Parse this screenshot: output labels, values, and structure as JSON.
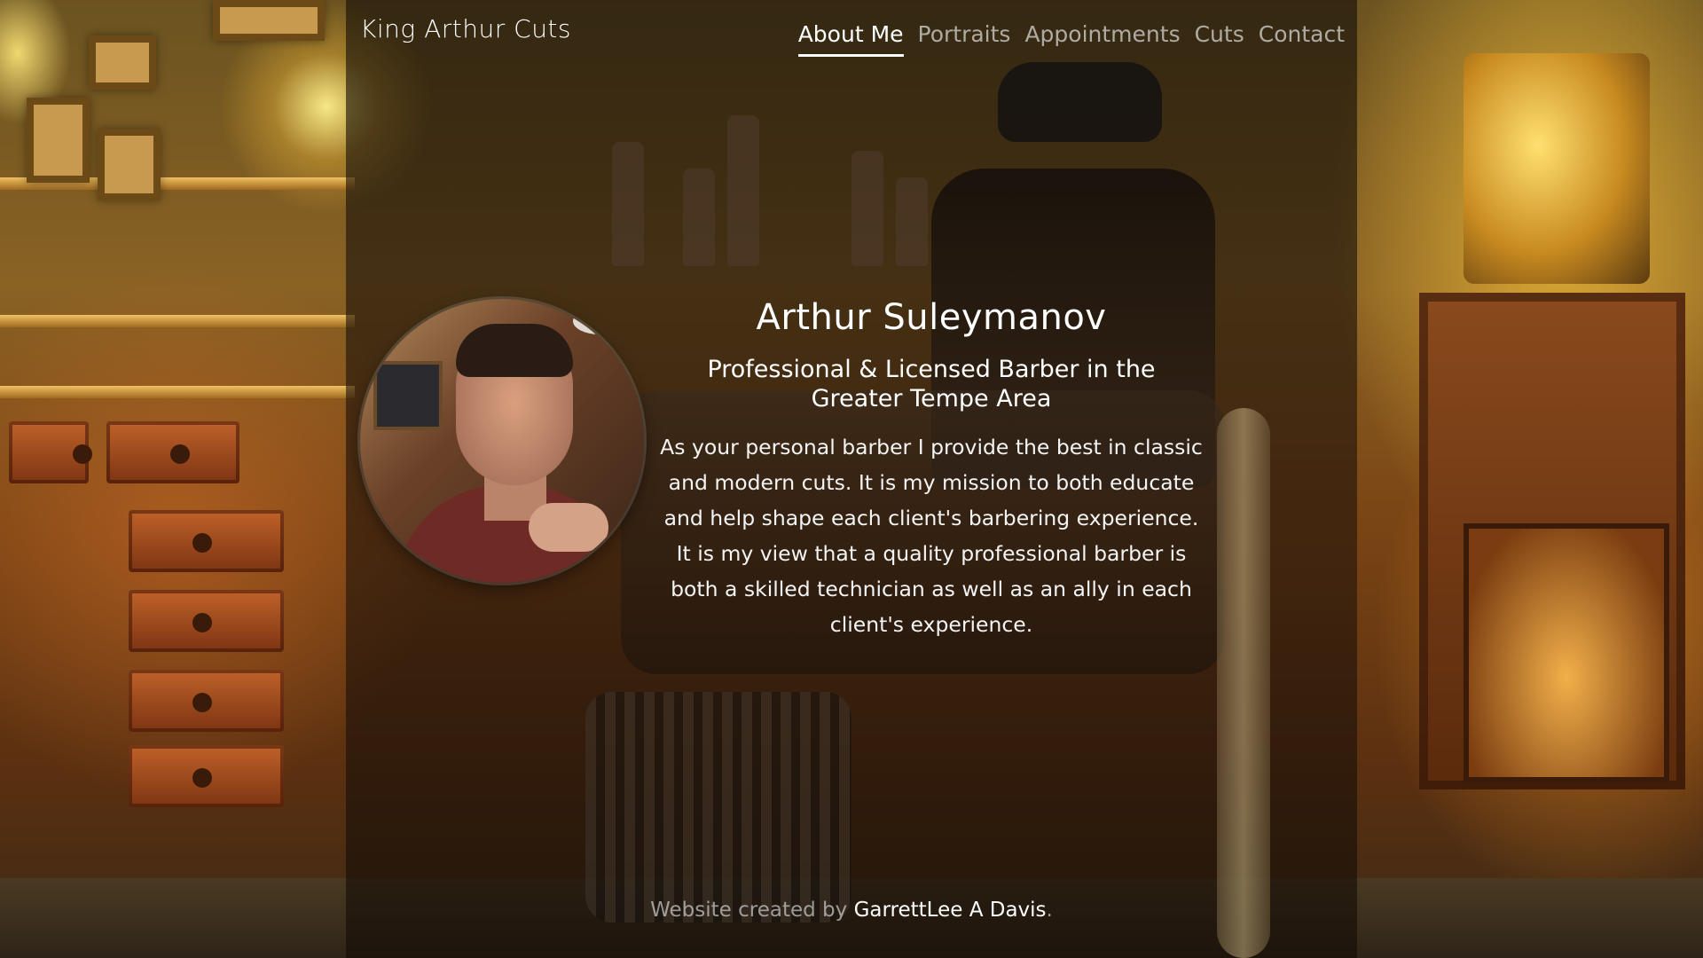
{
  "header": {
    "brand": "King Arthur Cuts",
    "nav": [
      {
        "label": "About Me",
        "active": true
      },
      {
        "label": "Portraits",
        "active": false
      },
      {
        "label": "Appointments",
        "active": false
      },
      {
        "label": "Cuts",
        "active": false
      },
      {
        "label": "Contact",
        "active": false
      }
    ]
  },
  "profile": {
    "name": "Arthur Suleymanov",
    "subtitle": "Professional & Licensed Barber in the Greater Tempe Area",
    "bio": "As your personal barber I provide the best in classic and modern cuts. It is my mission to both educate and help shape each client's barbering experience. It is my view that a quality professional barber is both a skilled technician as well as an ally in each client's experience."
  },
  "footer": {
    "prefix": "Website created by ",
    "author": "GarrettLee A Davis",
    "suffix": "."
  },
  "colors": {
    "text": "#ffffff",
    "nav_inactive": "#dcdcdc",
    "overlay": "#1e120a"
  }
}
